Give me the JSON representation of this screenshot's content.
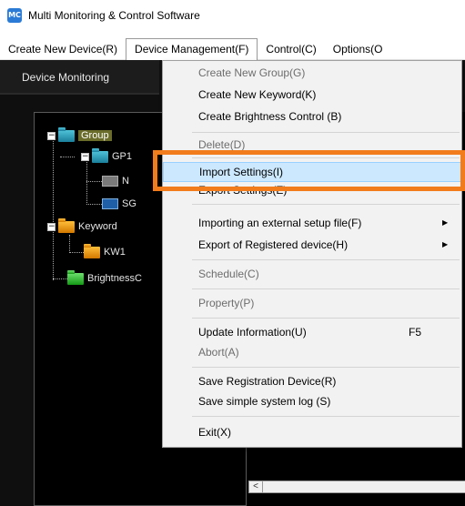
{
  "window": {
    "title": "Multi Monitoring & Control Software",
    "app_icon_label": "MC"
  },
  "menubar": {
    "items": [
      "Create New Device(R)",
      "Device Management(F)",
      "Control(C)",
      "Options(O"
    ]
  },
  "tabs": {
    "device_monitoring": "Device Monitoring"
  },
  "tree": {
    "group": "Group",
    "gp1": "GP1",
    "device_n": "N",
    "device_sg": "SG",
    "keyword": "Keyword",
    "kw1": "KW1",
    "brightness": "BrightnessC",
    "expander_symbol": "−"
  },
  "dropdown": {
    "create_new_group": "Create New Group(G)",
    "create_new_keyword": "Create New Keyword(K)",
    "create_brightness_control": "Create Brightness Control (B)",
    "delete": "Delete(D)",
    "import_settings": "Import Settings(I)",
    "export_settings": "Export Settings(E)",
    "importing_external": "Importing an external setup file(F)",
    "export_registered": "Export of Registered device(H)",
    "schedule": "Schedule(C)",
    "property": "Property(P)",
    "update_information": "Update Information(U)",
    "update_shortcut": "F5",
    "abort": "Abort(A)",
    "save_registration": "Save Registration Device(R)",
    "save_system_log": "Save simple system log (S)",
    "exit": "Exit(X)",
    "submenu_arrow": "▶"
  },
  "scroll": {
    "left_arrow": "<"
  },
  "colors": {
    "highlight_frame": "#f27c1c",
    "selection": "#cce8ff"
  }
}
